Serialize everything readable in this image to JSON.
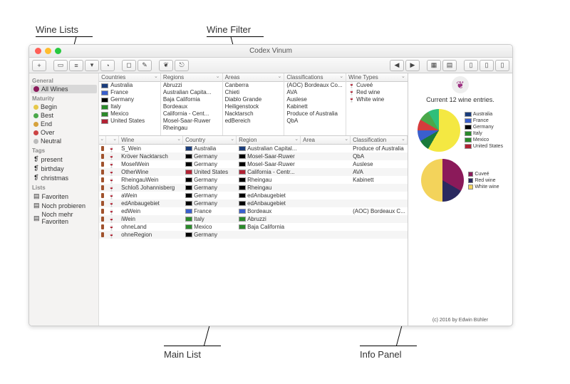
{
  "annotations": {
    "wine_lists": "Wine Lists",
    "wine_filter": "Wine Filter",
    "main_list": "Main List",
    "info_panel": "Info Panel"
  },
  "window_title": "Codex Vinum",
  "sidebar": {
    "general_head": "General",
    "all_wines": "All Wines",
    "maturity_head": "Maturity",
    "begin": "Begin",
    "best": "Best",
    "end": "End",
    "over": "Over",
    "neutral": "Neutral",
    "tags_head": "Tags",
    "present": "present",
    "birthday": "birthday",
    "christmas": "christmas",
    "lists_head": "Lists",
    "favoriten": "Favoriten",
    "noch": "Noch probieren",
    "noch_mehr": "Noch mehr Favoriten"
  },
  "filters": {
    "countries": {
      "head": "Countries",
      "items": [
        "Australia",
        "France",
        "Germany",
        "Italy",
        "Mexico",
        "United States"
      ]
    },
    "regions": {
      "head": "Regions",
      "items": [
        "Abruzzi",
        "Australian Capita...",
        "Baja California",
        "Bordeaux",
        "California - Cent...",
        "Mosel-Saar-Ruwer",
        "Rheingau"
      ]
    },
    "areas": {
      "head": "Areas",
      "items": [
        "Canberra",
        "Chieti",
        "Diablo Grande",
        "Heiligenstock",
        "Nacktarsch",
        "edBereich"
      ]
    },
    "classifications": {
      "head": "Classifications",
      "items": [
        "(AOC) Bordeaux Co...",
        "AVA",
        "Auslese",
        "Kabinett",
        "Produce of Australia",
        "QbA"
      ]
    },
    "winetypes": {
      "head": "Wine Types",
      "items": [
        "Cuveé",
        "Red wine",
        "White wine"
      ]
    }
  },
  "table": {
    "cols": {
      "wine": "Wine",
      "country": "Country",
      "region": "Region",
      "area": "Area",
      "class": "Classification"
    },
    "rows": [
      {
        "wine": "S_Wein",
        "country": "Australia",
        "region": "Australian Capital...",
        "area": "",
        "class": "Produce of Australia"
      },
      {
        "wine": "Kröver Nacktarsch",
        "country": "Germany",
        "region": "Mosel-Saar-Ruwer",
        "area": "",
        "class": "QbA"
      },
      {
        "wine": "MoselWein",
        "country": "Germany",
        "region": "Mosel-Saar-Ruwer",
        "area": "",
        "class": "Auslese"
      },
      {
        "wine": "OtherWine",
        "country": "United States",
        "region": "California - Centr...",
        "area": "",
        "class": "AVA"
      },
      {
        "wine": "RheingauWein",
        "country": "Germany",
        "region": "Rheingau",
        "area": "",
        "class": "Kabinett"
      },
      {
        "wine": "Schloß Johannisberg",
        "country": "Germany",
        "region": "Rheingau",
        "area": "",
        "class": ""
      },
      {
        "wine": "aWein",
        "country": "Germany",
        "region": "edAnbaugebiet",
        "area": "",
        "class": ""
      },
      {
        "wine": "edAnbaugebiet",
        "country": "Germany",
        "region": "edAnbaugebiet",
        "area": "",
        "class": ""
      },
      {
        "wine": "edWein",
        "country": "France",
        "region": "Bordeaux",
        "area": "",
        "class": "(AOC) Bordeaux C..."
      },
      {
        "wine": "iWein",
        "country": "Italy",
        "region": "Abruzzi",
        "area": "",
        "class": ""
      },
      {
        "wine": "ohneLand",
        "country": "Mexico",
        "region": "Baja California",
        "area": "",
        "class": ""
      },
      {
        "wine": "ohneRegion",
        "country": "Germany",
        "region": "",
        "area": "",
        "class": ""
      }
    ]
  },
  "info": {
    "title": "Current 12 wine entries.",
    "credit": "(c) 2016 by Edwin Bühler"
  },
  "chart_data": [
    {
      "type": "pie",
      "title": "Countries",
      "series": [
        {
          "name": "Germany",
          "value": 7,
          "color": "#f4e842"
        },
        {
          "name": "Australia",
          "value": 1,
          "color": "#1a7a3a"
        },
        {
          "name": "France",
          "value": 1,
          "color": "#3a5fcd"
        },
        {
          "name": "Italy",
          "value": 1,
          "color": "#d63c3c"
        },
        {
          "name": "Mexico",
          "value": 1,
          "color": "#4aa84a"
        },
        {
          "name": "United States",
          "value": 1,
          "color": "#2fbf7a"
        }
      ],
      "legend": [
        "Australia",
        "France",
        "Germany",
        "Italy",
        "Mexico",
        "United States"
      ]
    },
    {
      "type": "pie",
      "title": "Wine Types",
      "series": [
        {
          "name": "Cuveé",
          "value": 4,
          "color": "#8b1a5a"
        },
        {
          "name": "Red wine",
          "value": 2,
          "color": "#2a2a60"
        },
        {
          "name": "White wine",
          "value": 6,
          "color": "#f3d35b"
        }
      ],
      "legend": [
        "Cuveé",
        "Red wine",
        "White wine"
      ]
    }
  ],
  "flag_colors": {
    "Australia": "#1a3d7c",
    "France": "#3a5fcd",
    "Germany": "#000",
    "Italy": "#2a8a2a",
    "Mexico": "#2a8a2a",
    "United States": "#b22234"
  }
}
